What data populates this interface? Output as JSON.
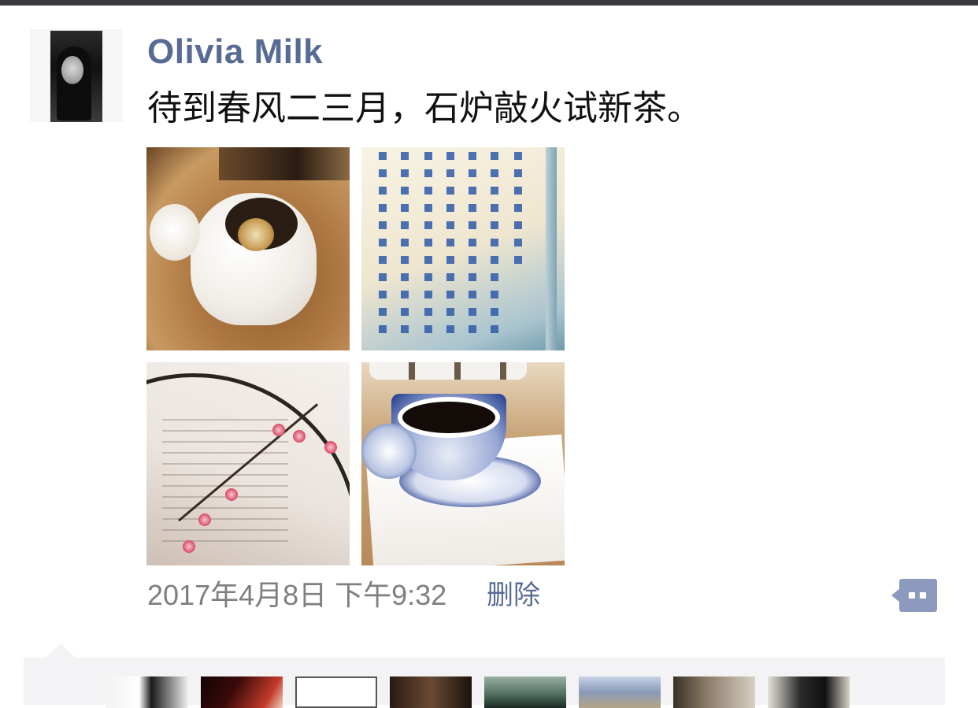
{
  "post": {
    "username": "Olivia Milk",
    "text": "待到春风二三月，石炉敲火试新茶。",
    "photos": [
      {
        "description": "tea-jar-photo"
      },
      {
        "description": "calligraphy-photo"
      },
      {
        "description": "blossom-fan-photo"
      },
      {
        "description": "tea-cup-photo"
      }
    ],
    "timestamp": "2017年4月8日 下午9:32",
    "delete_label": "删除"
  },
  "likes": {
    "avatars": [
      "liker-1",
      "liker-2",
      "liker-3",
      "liker-4",
      "liker-5",
      "liker-6",
      "liker-7",
      "liker-8"
    ]
  },
  "colors": {
    "name_link": "#576b95",
    "timestamp": "#7f7f7f",
    "comment_button": "#8c9bbd",
    "likes_background": "#f3f3f5",
    "top_bar": "#3a3a3e"
  },
  "icons": {
    "comment_button": "comment-dots-icon"
  }
}
